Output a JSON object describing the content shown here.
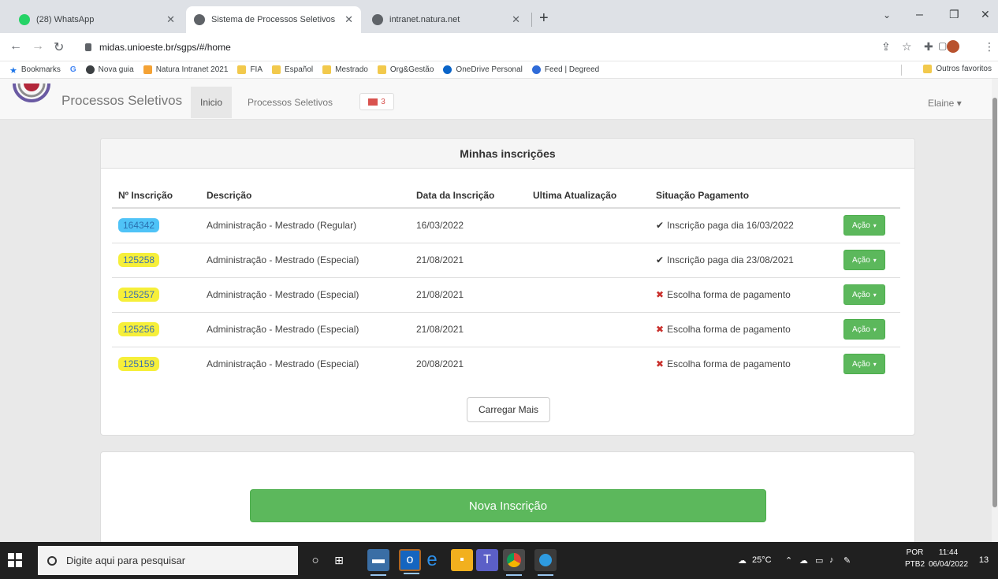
{
  "browser": {
    "tabs": [
      {
        "title": "(28) WhatsApp",
        "color": "#25d366",
        "active": false
      },
      {
        "title": "Sistema de Processos Seletivos",
        "color": "#5f6368",
        "active": true
      },
      {
        "title": "intranet.natura.net",
        "color": "#5f6368",
        "active": false
      }
    ],
    "url": "midas.unioeste.br/sgps/#/home",
    "bookmarks": [
      {
        "label": "Bookmarks",
        "icon": "star-icon"
      },
      {
        "label": "G",
        "icon": "google-icon"
      },
      {
        "label": "Nova guia",
        "icon": "globe-icon"
      },
      {
        "label": "Natura Intranet 2021",
        "icon": "natura-icon"
      },
      {
        "label": "FIA",
        "icon": "folder-icon"
      },
      {
        "label": "Español",
        "icon": "folder-icon"
      },
      {
        "label": "Mestrado",
        "icon": "folder-icon"
      },
      {
        "label": "Org&Gestão",
        "icon": "folder-icon"
      },
      {
        "label": "OneDrive Personal",
        "icon": "cloud-icon"
      },
      {
        "label": "Feed | Degreed",
        "icon": "degreed-icon"
      }
    ],
    "other_bookmarks": "Outros favoritos"
  },
  "app": {
    "brand": "Processos Seletivos",
    "nav": {
      "home": "Inicio",
      "processes": "Processos Seletivos"
    },
    "mail_count": "3",
    "user": "Elaine ▾"
  },
  "subscriptions": {
    "title": "Minhas inscrições",
    "columns": [
      "Nº Inscrição",
      "Descrição",
      "Data da Inscrição",
      "Ultima Atualização",
      "Situação Pagamento"
    ],
    "rows": [
      {
        "id": "164342",
        "description": "Administração - Mestrado (Regular)",
        "date": "16/03/2022",
        "updated": "",
        "status": "Inscrição paga dia 16/03/2022",
        "paid": true,
        "highlight": "blue"
      },
      {
        "id": "125258",
        "description": "Administração - Mestrado (Especial)",
        "date": "21/08/2021",
        "updated": "",
        "status": "Inscrição paga dia 23/08/2021",
        "paid": true,
        "highlight": "yellow"
      },
      {
        "id": "125257",
        "description": "Administração - Mestrado (Especial)",
        "date": "21/08/2021",
        "updated": "",
        "status": "Escolha forma de pagamento",
        "paid": false,
        "highlight": "yellow"
      },
      {
        "id": "125256",
        "description": "Administração - Mestrado (Especial)",
        "date": "21/08/2021",
        "updated": "",
        "status": "Escolha forma de pagamento",
        "paid": false,
        "highlight": "yellow"
      },
      {
        "id": "125159",
        "description": "Administração - Mestrado (Especial)",
        "date": "20/08/2021",
        "updated": "",
        "status": "Escolha forma de pagamento",
        "paid": false,
        "highlight": "yellow"
      }
    ],
    "action_label": "Ação",
    "load_more": "Carregar Mais"
  },
  "new_subscription": {
    "label": "Nova Inscrição"
  },
  "taskbar": {
    "search_placeholder": "Digite aqui para pesquisar",
    "weather": "25°C",
    "lang_top": "POR",
    "lang_bottom": "PTB2",
    "time": "11:44",
    "date": "06/04/2022",
    "notification_count": "13"
  },
  "colors": {
    "success": "#5cb85c",
    "danger": "#a94442",
    "link": "#337ab7",
    "highlight_yellow": "#f6ef3a",
    "highlight_blue": "#4fc3f7"
  }
}
